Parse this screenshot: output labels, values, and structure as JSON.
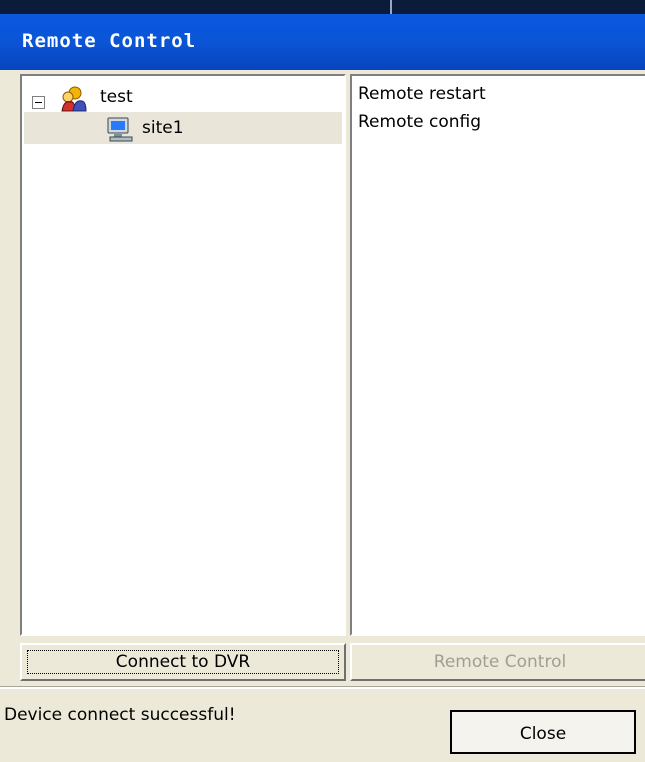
{
  "window": {
    "title": "Remote Control"
  },
  "tree": {
    "root": {
      "label": "test",
      "icon": "user-group-icon"
    },
    "children": [
      {
        "label": "site1",
        "icon": "computer-icon"
      }
    ]
  },
  "commands": [
    "Remote restart",
    "Remote config"
  ],
  "buttons": {
    "connect": "Connect to DVR",
    "remote_control": "Remote Control",
    "close": "Close"
  },
  "status": "Device connect successful!"
}
